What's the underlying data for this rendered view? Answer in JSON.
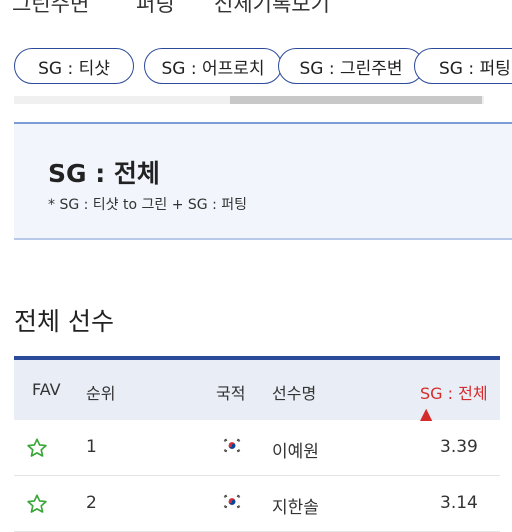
{
  "top_tabs": [
    "그린주변",
    "퍼팅",
    "전체기록보기"
  ],
  "chips": [
    "SG : 티샷",
    "SG : 어프로치",
    "SG : 그린주변",
    "SG : 퍼팅"
  ],
  "info": {
    "title": "SG : 전체",
    "note": "* SG : 티샷 to 그린 + SG : 퍼팅"
  },
  "section_title": "전체 선수",
  "table": {
    "headers": {
      "fav": "FAV",
      "rank": "순위",
      "nation": "국적",
      "player": "선수명",
      "stat": "SG : 전체 ▲"
    },
    "rows": [
      {
        "rank": "1",
        "player": "이예원",
        "stat": "3.39"
      },
      {
        "rank": "2",
        "player": "지한솔",
        "stat": "3.14"
      }
    ]
  },
  "colors": {
    "accent": "#2c4a9a",
    "sort_active": "#d62b2b",
    "fav_star": "#3aa63a"
  },
  "icons": {
    "fav": "star-outline-icon",
    "nation": "korea-flag-icon"
  }
}
